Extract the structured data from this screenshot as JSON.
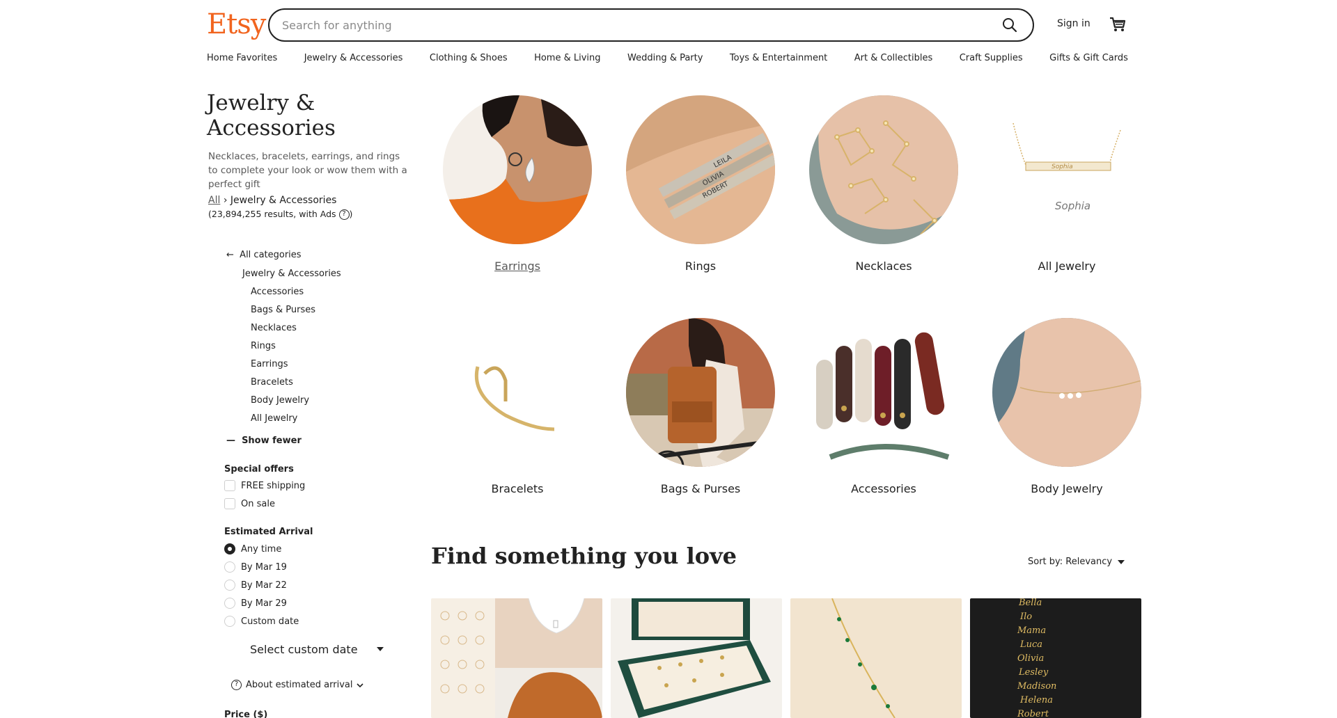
{
  "header": {
    "logo": "Etsy",
    "search_placeholder": "Search for anything",
    "search_icon": "search-icon",
    "sign_in": "Sign in",
    "cart_icon": "cart-icon"
  },
  "category_nav": [
    "Home Favorites",
    "Jewelry & Accessories",
    "Clothing & Shoes",
    "Home & Living",
    "Wedding & Party",
    "Toys & Entertainment",
    "Art & Collectibles",
    "Craft Supplies",
    "Gifts & Gift Cards"
  ],
  "sidebar": {
    "title": "Jewelry & Accessories",
    "description": "Necklaces, bracelets, earrings, and rings to complete your look or wow them with a perfect gift",
    "breadcrumb_all": "All",
    "breadcrumb_current": "Jewelry & Accessories",
    "results": "(23,894,255 results, with Ads",
    "results_close": ")",
    "all_categories": "All categories",
    "current_category": "Jewelry & Accessories",
    "subcategories": [
      "Accessories",
      "Bags & Purses",
      "Necklaces",
      "Rings",
      "Earrings",
      "Bracelets",
      "Body Jewelry",
      "All Jewelry"
    ],
    "show_fewer": "Show fewer",
    "special_offers": {
      "title": "Special offers",
      "options": [
        "FREE shipping",
        "On sale"
      ]
    },
    "estimated_arrival": {
      "title": "Estimated Arrival",
      "options": [
        "Any time",
        "By Mar 19",
        "By Mar 22",
        "By Mar 29",
        "Custom date"
      ],
      "selected": "Any time",
      "select_custom": "Select custom date",
      "about": "About estimated arrival"
    },
    "price_title": "Price ($)"
  },
  "tiles": [
    {
      "label": "Earrings"
    },
    {
      "label": "Rings"
    },
    {
      "label": "Necklaces"
    },
    {
      "label": "All Jewelry"
    },
    {
      "label": "Bracelets"
    },
    {
      "label": "Bags & Purses"
    },
    {
      "label": "Accessories"
    },
    {
      "label": "Body Jewelry"
    }
  ],
  "main": {
    "heading": "Find something you love",
    "sort_label": "Sort by: Relevancy",
    "ring_texts": [
      "LEILA",
      "OLIVIA",
      "ROBERT"
    ],
    "signature_text": "Sophia",
    "nameplate_names": [
      "Bella",
      "Ilo",
      "Mama",
      "Luca",
      "Olivia",
      "Lesley",
      "Madison",
      "Helena",
      "Robert"
    ]
  },
  "colors": {
    "accent": "#F1641E",
    "text": "#222222",
    "muted": "#595959"
  }
}
